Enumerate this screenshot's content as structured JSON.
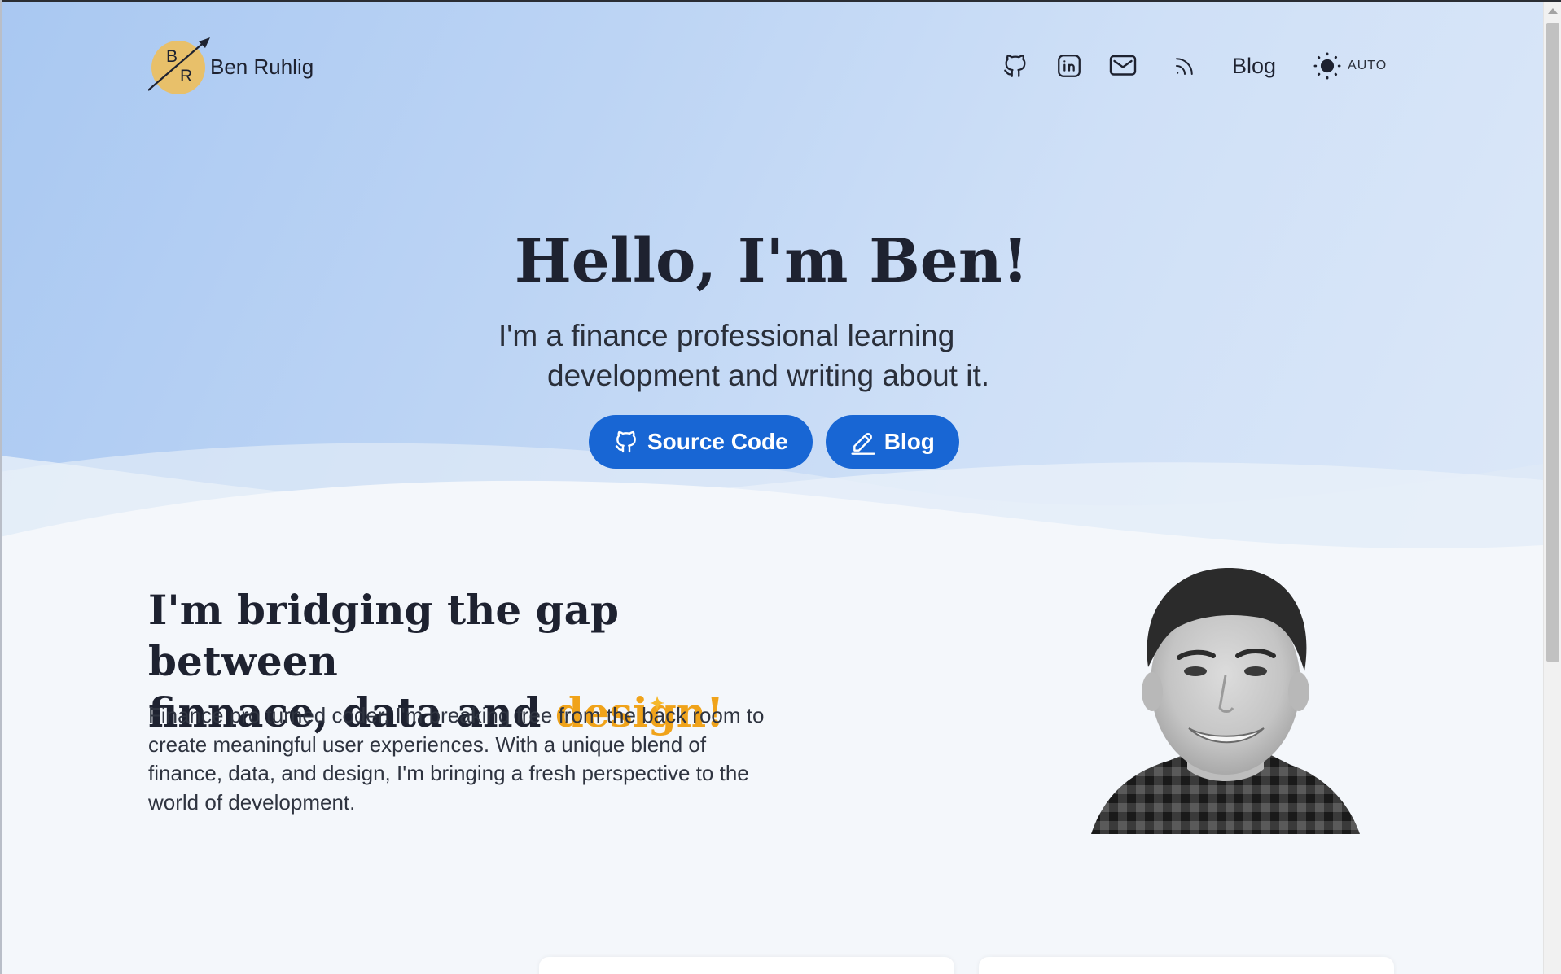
{
  "brand": {
    "logo_letters": [
      "B",
      "R"
    ],
    "name": "Ben Ruhlig",
    "logo_color": "#e8c06a"
  },
  "nav": {
    "icons": [
      "github-icon",
      "linkedin-icon",
      "mail-icon",
      "rss-icon"
    ],
    "blog_label": "Blog",
    "theme_icon": "sun-icon",
    "theme_label": "AUTO"
  },
  "hero": {
    "title": "Hello, I'm Ben!",
    "subtitle_line1": "I'm a finance professional learning",
    "subtitle_line2": "development and writing about it.",
    "buttons": [
      {
        "label": "Source Code",
        "icon": "github-icon"
      },
      {
        "label": "Blog",
        "icon": "pencil-icon"
      }
    ],
    "button_color": "#1866d4"
  },
  "about": {
    "title_line1": "I'm bridging the gap between",
    "title_line2_prefix": "finnace, data and ",
    "title_highlight": "design!",
    "highlight_color": "#f0a31a",
    "text": "Finance pro turned coder, I'm breaking free from the back room to create meaningful user experiences. With a unique blend of finance, data, and design, I'm bringing a fresh perspective to the world of development."
  }
}
